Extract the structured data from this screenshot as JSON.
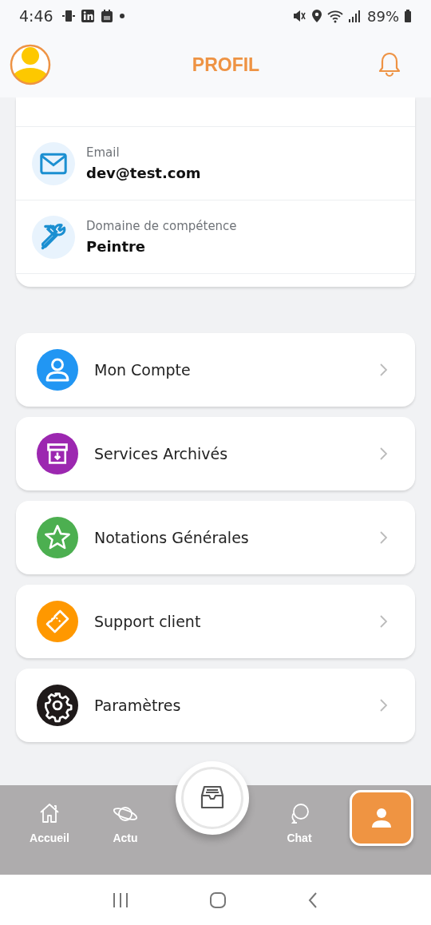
{
  "status_bar": {
    "time": "4:46",
    "battery": "89%"
  },
  "header": {
    "title": "PROFIL"
  },
  "info": [
    {
      "label": "Email",
      "value": "dev@test.com"
    },
    {
      "label": "Domaine de compétence",
      "value": "Peintre"
    }
  ],
  "menu": [
    {
      "label": "Mon Compte",
      "color": "#2196f3"
    },
    {
      "label": "Services Archivés",
      "color": "#9c27b0"
    },
    {
      "label": "Notations Générales",
      "color": "#4caf50"
    },
    {
      "label": "Support client",
      "color": "#ff9800"
    },
    {
      "label": "Paramètres",
      "color": "#1f1a1a"
    }
  ],
  "bottom_nav": [
    {
      "label": "Accueil",
      "selected": false
    },
    {
      "label": "Actu",
      "selected": false
    },
    {
      "kind": "center",
      "selected": false
    },
    {
      "label": "Chat",
      "selected": false
    },
    {
      "kind": "profile",
      "selected": true
    }
  ]
}
